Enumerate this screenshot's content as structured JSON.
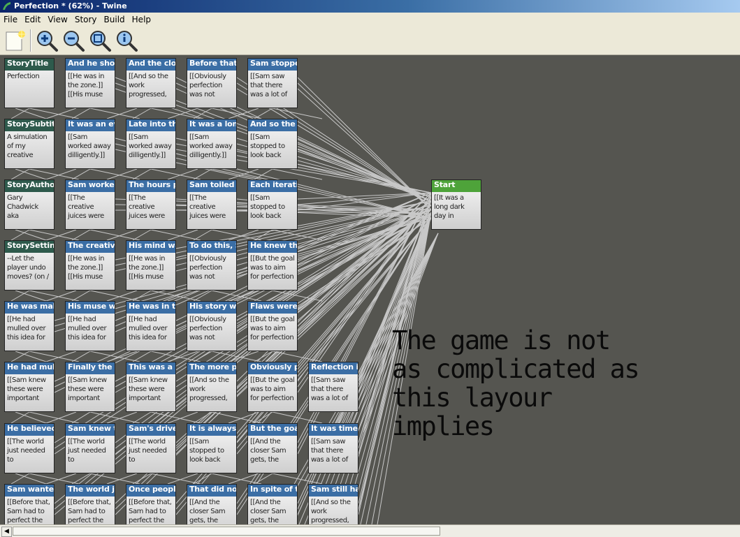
{
  "window": {
    "title": "Perfection * (62%) - Twine"
  },
  "menu": [
    "File",
    "Edit",
    "View",
    "Story",
    "Build",
    "Help"
  ],
  "toolbar": {
    "icons": [
      "new-passage-icon",
      "zoom-in-icon",
      "zoom-out-icon",
      "zoom-fit-icon",
      "info-icon"
    ]
  },
  "cards": [
    {
      "title": "StoryTitle",
      "body": "Perfection",
      "col": 0,
      "row": 0,
      "kind": "special"
    },
    {
      "title": "And he show",
      "body": "[[He was in\nthe zone.]]\n[[His muse",
      "col": 1,
      "row": 0
    },
    {
      "title": "And the clos",
      "body": "[[And so the\nwork\nprogressed,",
      "col": 2,
      "row": 0
    },
    {
      "title": "Before that, S",
      "body": "[[Obviously\nperfection\nwas not",
      "col": 3,
      "row": 0
    },
    {
      "title": "Sam stopped",
      "body": "[[Sam saw\nthat there\nwas a lot of",
      "col": 4,
      "row": 0
    },
    {
      "title": "StorySubtitle",
      "body": "A simulation\nof my\ncreative",
      "col": 0,
      "row": 1,
      "kind": "special"
    },
    {
      "title": "It was an eve",
      "body": "[[Sam\nworked away\ndilligently.]]",
      "col": 1,
      "row": 1
    },
    {
      "title": "Late into the",
      "body": "[[Sam\nworked away\ndilligently.]]",
      "col": 2,
      "row": 1
    },
    {
      "title": "It was a long",
      "body": "[[Sam\nworked away\ndilligently.]]",
      "col": 3,
      "row": 1
    },
    {
      "title": "And so the w",
      "body": "[[Sam\nstopped to\nlook back",
      "col": 4,
      "row": 1
    },
    {
      "title": "StoryAuthor",
      "body": "Gary\nChadwick\naka",
      "col": 0,
      "row": 2,
      "kind": "special"
    },
    {
      "title": "Sam worked",
      "body": "[[The\ncreative\njuices were",
      "col": 1,
      "row": 2
    },
    {
      "title": "The hours pa",
      "body": "[[The\ncreative\njuices were",
      "col": 2,
      "row": 2
    },
    {
      "title": "Sam toiled o",
      "body": "[[The\ncreative\njuices were",
      "col": 3,
      "row": 2
    },
    {
      "title": "Each iteratio",
      "body": "[[Sam\nstopped to\nlook back",
      "col": 4,
      "row": 2
    },
    {
      "title": "StorySettings",
      "body": "--Let the\nplayer undo\nmoves? (on /",
      "col": 0,
      "row": 3,
      "kind": "special"
    },
    {
      "title": "The creative j",
      "body": "[[He was in\nthe zone.]]\n[[His muse",
      "col": 1,
      "row": 3
    },
    {
      "title": "His mind was",
      "body": "[[He was in\nthe zone.]]\n[[His muse",
      "col": 2,
      "row": 3
    },
    {
      "title": "To do this, Sa",
      "body": "[[Obviously\nperfection\nwas not",
      "col": 3,
      "row": 3
    },
    {
      "title": "He knew that",
      "body": "[[But the goal\nwas to aim\nfor perfection",
      "col": 4,
      "row": 3
    },
    {
      "title": "He was makir",
      "body": "[[He had\nmulled over\nthis idea for",
      "col": 0,
      "row": 4
    },
    {
      "title": "His muse was",
      "body": "[[He had\nmulled over\nthis idea for",
      "col": 1,
      "row": 4
    },
    {
      "title": "He was in the",
      "body": "[[He had\nmulled over\nthis idea for",
      "col": 2,
      "row": 4
    },
    {
      "title": "His story wou",
      "body": "[[Obviously\nperfection\nwas not",
      "col": 3,
      "row": 4
    },
    {
      "title": "Flaws were ir",
      "body": "[[But the goal\nwas to aim\nfor perfection",
      "col": 4,
      "row": 4
    },
    {
      "title": "He had mulle",
      "body": "[[Sam knew\nthese were\nimportant",
      "col": 0,
      "row": 5
    },
    {
      "title": "Finally the th",
      "body": "[[Sam knew\nthese were\nimportant",
      "col": 1,
      "row": 5
    },
    {
      "title": "This was a pr",
      "body": "[[Sam knew\nthese were\nimportant",
      "col": 2,
      "row": 5
    },
    {
      "title": "The more per",
      "body": "[[And so the\nwork\nprogressed,",
      "col": 3,
      "row": 5
    },
    {
      "title": "Obviously pe",
      "body": "[[But the goal\nwas to aim\nfor perfection",
      "col": 4,
      "row": 5
    },
    {
      "title": "Reflection is",
      "body": "[[Sam saw\nthat there\nwas a lot of",
      "col": 5,
      "row": 5
    },
    {
      "title": "He believed i",
      "body": "[[The world\njust needed\nto",
      "col": 0,
      "row": 6
    },
    {
      "title": "Sam knew th",
      "body": "[[The world\njust needed\nto",
      "col": 1,
      "row": 6
    },
    {
      "title": "Sam's drive c",
      "body": "[[The world\njust needed\nto",
      "col": 2,
      "row": 6
    },
    {
      "title": "It is always in",
      "body": "[[Sam\nstopped to\nlook back",
      "col": 3,
      "row": 6
    },
    {
      "title": "But the goal",
      "body": "[[And the\ncloser Sam\ngets, the",
      "col": 4,
      "row": 6
    },
    {
      "title": "It was time to",
      "body": "[[Sam saw\nthat there\nwas a lot of",
      "col": 5,
      "row": 6
    },
    {
      "title": "Sam wanted",
      "body": "[[Before that,\nSam had to\nperfect the",
      "col": 0,
      "row": 7
    },
    {
      "title": "The world jus",
      "body": "[[Before that,\nSam had to\nperfect the",
      "col": 1,
      "row": 7
    },
    {
      "title": "Once people",
      "body": "[[Before that,\nSam had to\nperfect the",
      "col": 2,
      "row": 7
    },
    {
      "title": "That did not",
      "body": "[[And the\ncloser Sam\ngets, the",
      "col": 3,
      "row": 7
    },
    {
      "title": "In spite of tha",
      "body": "[[And the\ncloser Sam\ngets, the",
      "col": 4,
      "row": 7
    },
    {
      "title": "Sam still had",
      "body": "[[And so the\nwork\nprogressed,",
      "col": 5,
      "row": 7
    }
  ],
  "start_card": {
    "title": "Start",
    "body": "[[It was a\nlong dark\nday in"
  },
  "note": "The game is not\nas complicated as\nthis layour\nimplies"
}
